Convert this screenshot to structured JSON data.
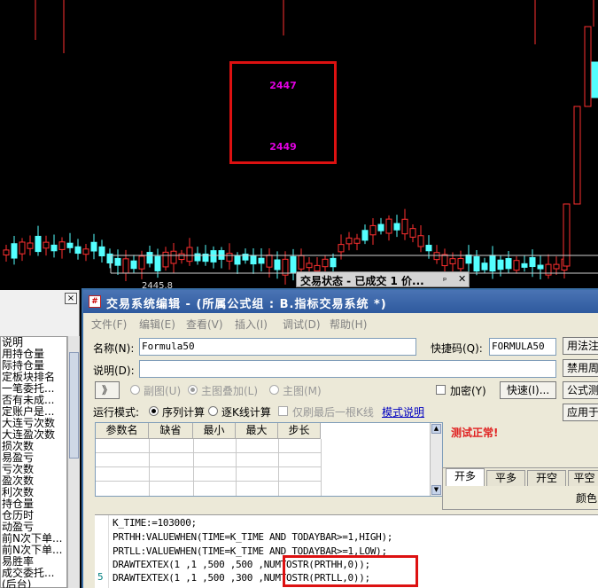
{
  "chart": {
    "annotations": [
      "2447",
      "2449"
    ],
    "price_tag": "2445.8",
    "colors": {
      "up": "#ff3030",
      "down": "#54ffff",
      "background": "#000000",
      "annotation_box": "#dd1111"
    }
  },
  "left_panel": {
    "close_icon": "×",
    "items": [
      "说明",
      "用持仓量",
      "际持仓量",
      "定板块排名",
      "一笔委托...",
      "否有未成...",
      "定账户是...",
      "大连亏次数",
      "大连盈次数",
      "损次数",
      "易盈亏",
      "亏次数",
      "盈次数",
      "利次数",
      "持仓量",
      "仓历时",
      "动盈亏",
      "前N次下单...",
      "前N次下单...",
      "易胜率",
      "成交委托...",
      "(后台)"
    ]
  },
  "status_window": {
    "title": "交易状态 - 已成交 1 价...",
    "pin_icon": "ₚ",
    "close_icon": "✕"
  },
  "editor": {
    "title": "交易系统编辑 - (所属公式组 : B.指标交易系统 *)",
    "menu": [
      "文件(F)",
      "编辑(E)",
      "查看(V)",
      "插入(I)",
      "调试(D)",
      "帮助(H)"
    ],
    "name_label": "名称(N):",
    "name_value": "Formula50",
    "shortcut_label": "快捷码(Q):",
    "shortcut_value": "FORMULA50",
    "desc_label": "说明(D):",
    "desc_value": "",
    "expand_button": "》",
    "chart_modes": [
      "副图(U)",
      "主图叠加(L)",
      "主图(M)"
    ],
    "encrypt_label": "加密(Y)",
    "quick_button": "快速(I)...",
    "run_mode_label": "运行模式:",
    "run_modes": [
      "序列计算",
      "逐K线计算"
    ],
    "last_bar_label": "仅刷最后一根K线",
    "mode_help_link": "模式说明",
    "param_headers": [
      "参数名",
      "缺省",
      "最小",
      "最大",
      "步长"
    ],
    "test_status": "测试正常!",
    "right_buttons": [
      "用法注",
      "禁用周",
      "公式测",
      "应用于"
    ],
    "tabs": [
      "开多",
      "平多",
      "开空",
      "平空"
    ],
    "color_label": "颜色",
    "line_numbers": [
      "5"
    ],
    "code_lines": [
      "K_TIME:=103000;",
      "PRTHH:VALUEWHEN(TIME=K_TIME AND TODAYBAR>=1,HIGH);",
      "PRTLL:VALUEWHEN(TIME=K_TIME AND TODAYBAR>=1,LOW);",
      "DRAWTEXTEX(1 ,1 ,500 ,500 ,NUMTOSTR(PRTHH,0));",
      "DRAWTEXTEX(1 ,1 ,500 ,300 ,NUMTOSTR(PRTLL,0));"
    ]
  }
}
